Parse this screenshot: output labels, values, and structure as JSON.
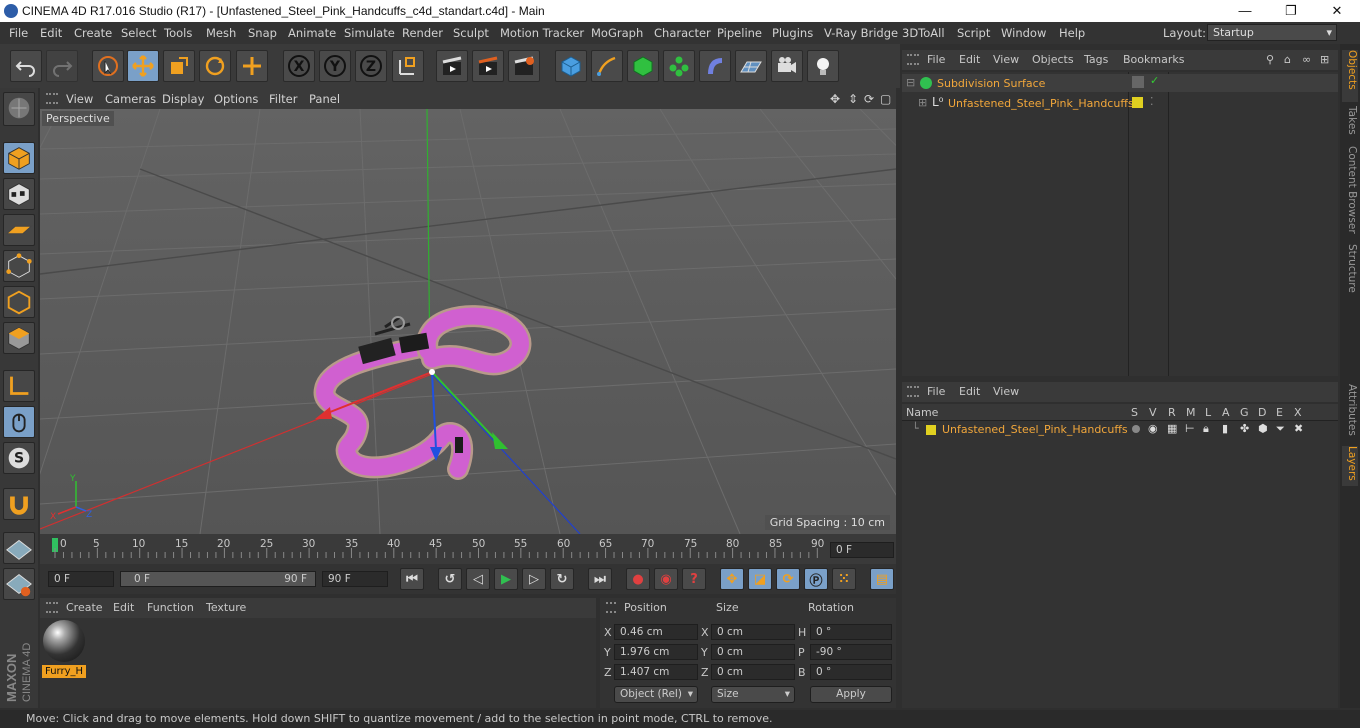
{
  "window": {
    "title": "CINEMA 4D R17.016 Studio (R17) - [Unfastened_Steel_Pink_Handcuffs_c4d_standart.c4d] - Main",
    "min": "—",
    "max": "❐",
    "close": "✕"
  },
  "menu": [
    "File",
    "Edit",
    "Create",
    "Select",
    "Tools",
    "Mesh",
    "Snap",
    "Animate",
    "Simulate",
    "Render",
    "Sculpt",
    "Motion Tracker",
    "MoGraph",
    "Character",
    "Pipeline",
    "Plugins",
    "V-Ray Bridge",
    "3DToAll",
    "Script",
    "Window",
    "Help"
  ],
  "layout": {
    "label": "Layout:",
    "value": "Startup"
  },
  "viewport": {
    "menu": [
      "View",
      "Cameras",
      "Display",
      "Options",
      "Filter",
      "Panel"
    ],
    "label": "Perspective",
    "grid_spacing": "Grid Spacing : 10 cm",
    "axis_x": "X",
    "axis_y": "Y",
    "axis_z": "Z"
  },
  "timeline": {
    "ticks": [
      "0",
      "5",
      "10",
      "15",
      "20",
      "25",
      "30",
      "35",
      "40",
      "45",
      "50",
      "55",
      "60",
      "65",
      "70",
      "75",
      "80",
      "85",
      "90"
    ],
    "current_frame": "0 F",
    "start": "0 F",
    "range_start": "0 F",
    "range_end": "90 F",
    "end": "90 F"
  },
  "material_manager": {
    "menu": [
      "Create",
      "Edit",
      "Function",
      "Texture"
    ],
    "material_name": "Furry_H"
  },
  "coordinates": {
    "headers": {
      "position": "Position",
      "size": "Size",
      "rotation": "Rotation"
    },
    "rows": [
      {
        "axis": "X",
        "pos": "0.46 cm",
        "size_axis": "X",
        "size": "0 cm",
        "rot_axis": "H",
        "rot": "0 °"
      },
      {
        "axis": "Y",
        "pos": "1.976 cm",
        "size_axis": "Y",
        "size": "0 cm",
        "rot_axis": "P",
        "rot": "-90 °"
      },
      {
        "axis": "Z",
        "pos": "1.407 cm",
        "size_axis": "Z",
        "size": "0 cm",
        "rot_axis": "B",
        "rot": "0 °"
      }
    ],
    "mode": "Object (Rel)",
    "size_mode": "Size",
    "apply": "Apply"
  },
  "object_manager": {
    "menu": [
      "File",
      "Edit",
      "View",
      "Objects",
      "Tags",
      "Bookmarks"
    ],
    "objects": [
      {
        "name": "Subdivision Surface"
      },
      {
        "name": "Unfastened_Steel_Pink_Handcuffs"
      }
    ]
  },
  "layer_manager": {
    "menu": [
      "File",
      "Edit",
      "View"
    ],
    "columns": [
      "Name",
      "S",
      "V",
      "R",
      "M",
      "L",
      "A",
      "G",
      "D",
      "E",
      "X"
    ],
    "layers": [
      {
        "name": "Unfastened_Steel_Pink_Handcuffs"
      }
    ]
  },
  "right_tabs": [
    "Objects",
    "Takes",
    "Content Browser",
    "Structure",
    "Attributes",
    "Layers"
  ],
  "branding": {
    "maxon": "MAXON",
    "cinema": "CINEMA 4D"
  },
  "status": "Move: Click and drag to move elements. Hold down SHIFT to quantize movement / add to the selection in point mode, CTRL to remove.",
  "colors": {
    "accent": "#7aa0c8",
    "selection": "#f2a73b",
    "layer": "#e0d020",
    "object_pink": "#d060d0"
  }
}
